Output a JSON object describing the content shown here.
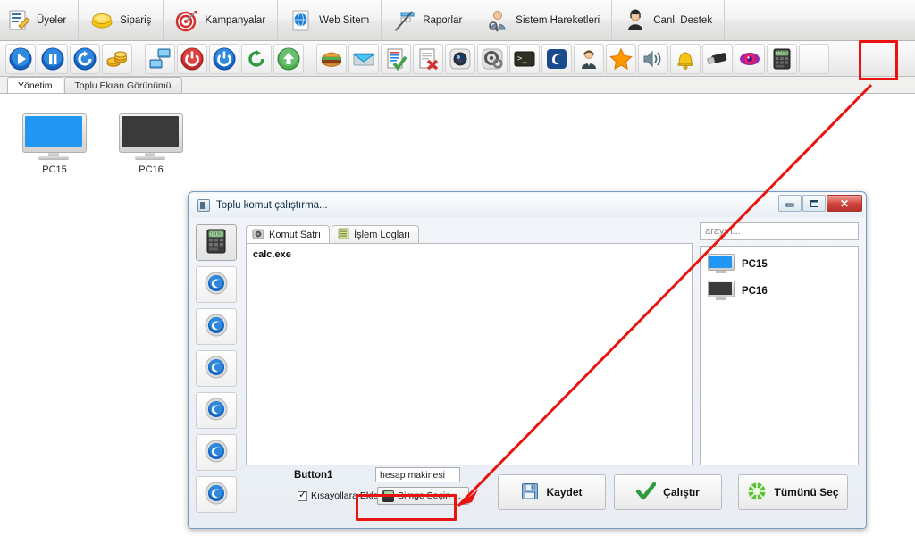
{
  "menubar": {
    "items": [
      {
        "label": "Üyeler",
        "icon": "members-icon"
      },
      {
        "label": "Sipariş",
        "icon": "order-icon"
      },
      {
        "label": "Kampanyalar",
        "icon": "target-icon"
      },
      {
        "label": "Web Sitem",
        "icon": "globe-icon"
      },
      {
        "label": "Raporlar",
        "icon": "chart-icon"
      },
      {
        "label": "Sistem Hareketleri",
        "icon": "user-search-icon"
      },
      {
        "label": "Canlı Destek",
        "icon": "support-agent-icon"
      }
    ]
  },
  "toolbar": {
    "buttons": [
      {
        "icon": "play-icon"
      },
      {
        "icon": "pause-icon"
      },
      {
        "icon": "refresh-icon"
      },
      {
        "icon": "coins-icon"
      },
      {
        "icon": "network-icon"
      },
      {
        "icon": "shutdown-icon"
      },
      {
        "icon": "power-icon"
      },
      {
        "icon": "restart-icon"
      },
      {
        "icon": "upload-icon"
      },
      {
        "icon": "burger-icon"
      },
      {
        "icon": "mail-icon"
      },
      {
        "icon": "document-check-icon"
      },
      {
        "icon": "document-delete-icon"
      },
      {
        "icon": "camera-icon"
      },
      {
        "icon": "settings-gear-icon"
      },
      {
        "icon": "terminal-icon"
      },
      {
        "icon": "browser-icon"
      },
      {
        "icon": "user-icon"
      },
      {
        "icon": "star-icon"
      },
      {
        "icon": "volume-icon"
      },
      {
        "icon": "bell-icon"
      },
      {
        "icon": "usb-icon"
      },
      {
        "icon": "eye-icon"
      },
      {
        "icon": "calculator-icon"
      }
    ]
  },
  "page_tabs": [
    {
      "label": "Yönetim",
      "active": true
    },
    {
      "label": "Toplu Ekran Görünümü",
      "active": false
    }
  ],
  "desktop": {
    "computers": [
      {
        "name": "PC15",
        "screen_color": "#2196f3"
      },
      {
        "name": "PC16",
        "screen_color": "#3a3a3a"
      }
    ]
  },
  "dialog": {
    "title": "Toplu komut çalıştırma...",
    "window_controls": {
      "minimize": "–",
      "maximize": "❐",
      "close": "✕"
    },
    "icon_strip": [
      {
        "icon": "calculator-icon",
        "selected": true
      },
      {
        "icon": "blue-gear-icon",
        "selected": false
      },
      {
        "icon": "blue-gear-icon",
        "selected": false
      },
      {
        "icon": "blue-gear-icon",
        "selected": false
      },
      {
        "icon": "blue-gear-icon",
        "selected": false
      },
      {
        "icon": "blue-gear-icon",
        "selected": false
      },
      {
        "icon": "blue-gear-icon",
        "selected": false
      }
    ],
    "tabs": [
      {
        "label": "Komut Satrı",
        "icon": "terminal-icon",
        "active": true
      },
      {
        "label": "İşlem Logları",
        "icon": "log-icon",
        "active": false
      }
    ],
    "command_text": "calc.exe",
    "search": {
      "placeholder": "arayın...",
      "value": ""
    },
    "computer_list": [
      {
        "name": "PC15",
        "screen_color": "#2196f3"
      },
      {
        "name": "PC16",
        "screen_color": "#3a3a3a"
      }
    ],
    "button_label": "Button1",
    "name_input": {
      "value": "hesap makinesi",
      "placeholder": ""
    },
    "shortcut_checkbox": {
      "label": "Kısayollara Ekle",
      "checked": true
    },
    "icon_picker_button": "Simge Seçin ...",
    "actions": [
      {
        "label": "Kaydet",
        "icon": "save-icon"
      },
      {
        "label": "Çalıştır",
        "icon": "check-icon"
      },
      {
        "label": "Tümünü Seç",
        "icon": "select-all-icon"
      }
    ]
  },
  "annotations": {
    "color": "#e8140f",
    "highlight_toolbar": "calculator-icon",
    "highlight_button": "Simge Seçin ..."
  }
}
